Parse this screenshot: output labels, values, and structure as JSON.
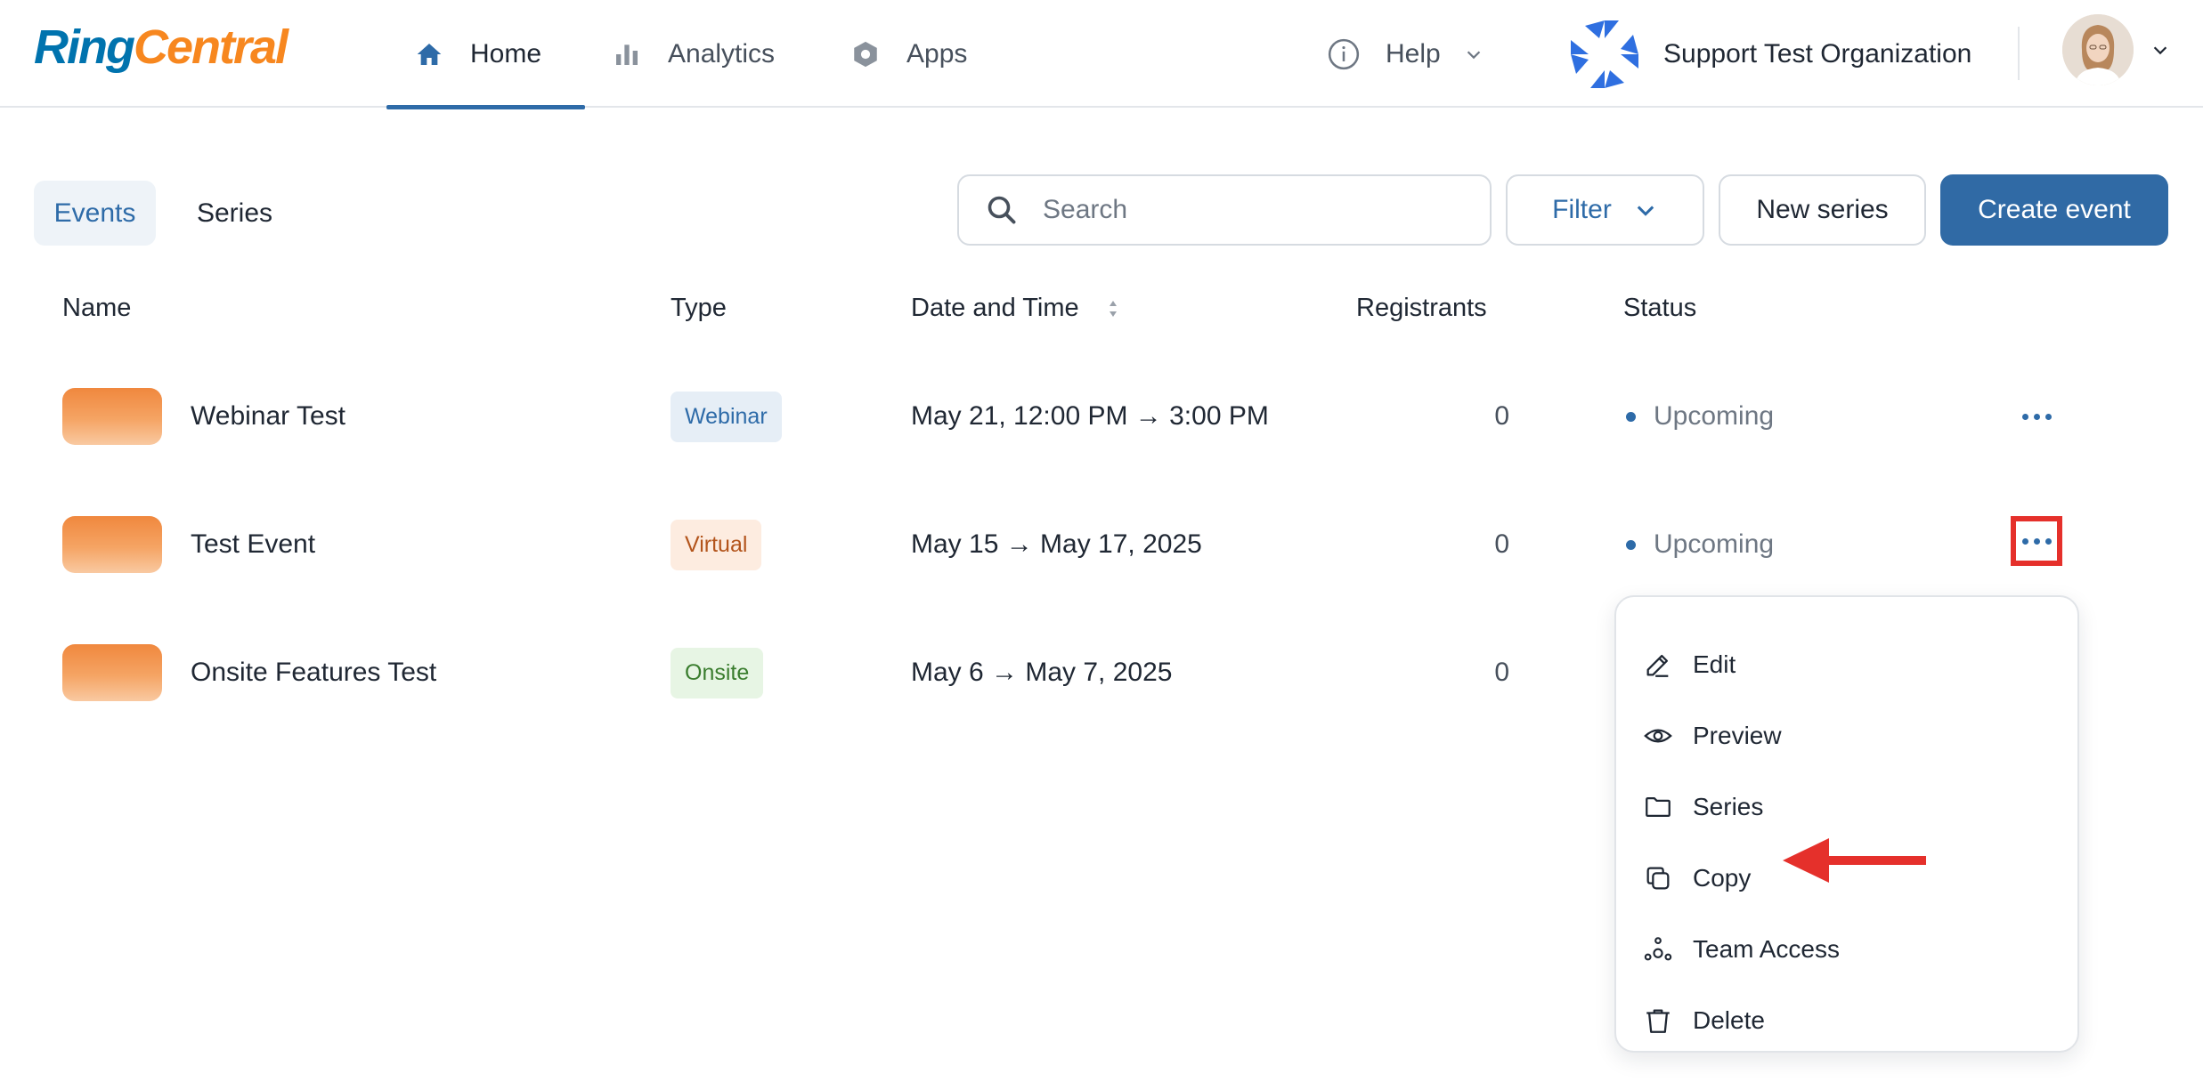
{
  "header": {
    "logo": {
      "ring": "Ring",
      "central": "Central"
    },
    "nav": [
      {
        "label": "Home",
        "icon": "home-icon",
        "active": true
      },
      {
        "label": "Analytics",
        "icon": "bar-chart-icon",
        "active": false
      },
      {
        "label": "Apps",
        "icon": "hexagon-icon",
        "active": false
      }
    ],
    "help_label": "Help",
    "organization": "Support Test Organization"
  },
  "toolbar": {
    "tabs": [
      {
        "label": "Events",
        "active": true
      },
      {
        "label": "Series",
        "active": false
      }
    ],
    "search_placeholder": "Search",
    "filter_label": "Filter",
    "new_series_label": "New series",
    "create_event_label": "Create event"
  },
  "table": {
    "columns": [
      "Name",
      "Type",
      "Date and Time",
      "Registrants",
      "Status"
    ],
    "rows": [
      {
        "name": "Webinar Test",
        "type": "Webinar",
        "datetime": "May 21, 12:00 PM → 3:00 PM",
        "registrants": "0",
        "status": "Upcoming"
      },
      {
        "name": "Test Event",
        "type": "Virtual",
        "datetime": "May 15 → May 17, 2025",
        "registrants": "0",
        "status": "Upcoming"
      },
      {
        "name": "Onsite Features Test",
        "type": "Onsite",
        "datetime": "May 6 → May 7, 2025",
        "registrants": "0",
        "status": ""
      }
    ]
  },
  "menu": {
    "items": [
      {
        "label": "Edit",
        "icon": "pencil-icon"
      },
      {
        "label": "Preview",
        "icon": "eye-icon"
      },
      {
        "label": "Series",
        "icon": "folder-icon"
      },
      {
        "label": "Copy",
        "icon": "copy-icon"
      },
      {
        "label": "Team Access",
        "icon": "team-icon"
      },
      {
        "label": "Delete",
        "icon": "trash-icon"
      }
    ]
  },
  "colors": {
    "accent": "#306aa5",
    "highlight_annotation": "#e5302b",
    "logo_blue": "#0073ae",
    "logo_orange": "#f7871f"
  }
}
